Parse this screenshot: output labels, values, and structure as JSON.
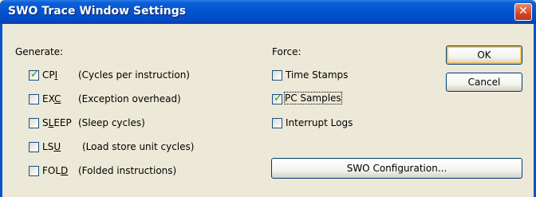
{
  "window": {
    "title": "SWO Trace Window Settings",
    "close_glyph": "✕"
  },
  "generate": {
    "heading": "Generate:",
    "items": [
      {
        "pre": "CP",
        "u": "I",
        "post": "",
        "desc": "(Cycles per instruction)",
        "checked": true
      },
      {
        "pre": "EX",
        "u": "C",
        "post": "",
        "desc": "(Exception overhead)",
        "checked": false
      },
      {
        "pre": "S",
        "u": "L",
        "post": "EEP",
        "desc": "(Sleep cycles)",
        "checked": false
      },
      {
        "pre": "LS",
        "u": "U",
        "post": "",
        "desc": "(Load store unit cycles)",
        "checked": false
      },
      {
        "pre": "FOL",
        "u": "D",
        "post": "",
        "desc": "(Folded instructions)",
        "checked": false
      }
    ]
  },
  "force": {
    "heading": "Force:",
    "items": [
      {
        "label": "Time Stamps",
        "checked": false
      },
      {
        "label": "PC Samples",
        "checked": true
      },
      {
        "label": "Interrupt Logs",
        "checked": false
      }
    ]
  },
  "buttons": {
    "ok": "OK",
    "cancel": "Cancel",
    "swo_config": "SWO Configuration..."
  },
  "colors": {
    "title_bar": "#0554d0",
    "dialog_bg": "#ece9d8",
    "check_mark": "#21a121",
    "default_button_ring": "#f0c45d"
  }
}
